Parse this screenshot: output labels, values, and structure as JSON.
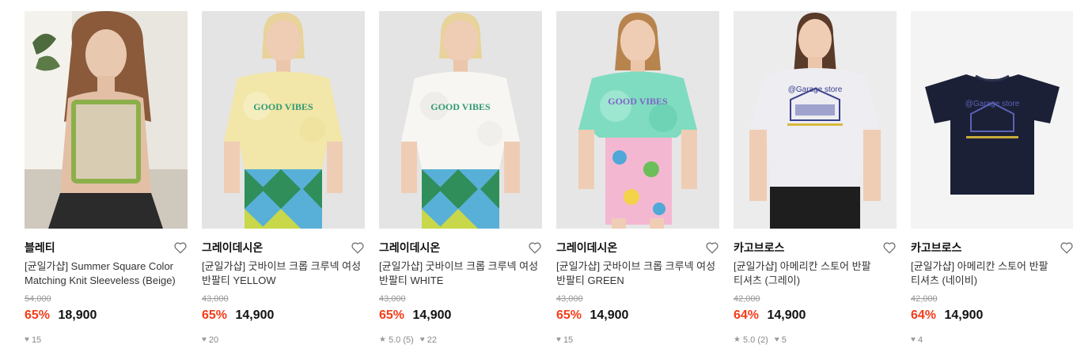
{
  "products": [
    {
      "brand": "블레티",
      "title_line1": "[균일가샵] Summer Square Color",
      "title_line2": "Matching Knit Sleeveless (Beige)",
      "original_price": "54,000",
      "discount": "65%",
      "price": "18,900",
      "rating": "",
      "likes": "15"
    },
    {
      "brand": "그레이데시온",
      "title_line1": "[균일가샵] 굿바이브 크롭 크루넥 여성",
      "title_line2": "반팔티 YELLOW",
      "original_price": "43,000",
      "discount": "65%",
      "price": "14,900",
      "rating": "",
      "likes": "20"
    },
    {
      "brand": "그레이데시온",
      "title_line1": "[균일가샵] 굿바이브 크롭 크루넥 여성",
      "title_line2": "반팔티 WHITE",
      "original_price": "43,000",
      "discount": "65%",
      "price": "14,900",
      "rating": "5.0 (5)",
      "likes": "22"
    },
    {
      "brand": "그레이데시온",
      "title_line1": "[균일가샵] 굿바이브 크롭 크루넥 여성",
      "title_line2": "반팔티 GREEN",
      "original_price": "43,000",
      "discount": "65%",
      "price": "14,900",
      "rating": "",
      "likes": "15"
    },
    {
      "brand": "카고브로스",
      "title_line1": "[균일가샵] 아메리칸 스토어 반팔",
      "title_line2": "티셔츠 (그레이)",
      "original_price": "42,000",
      "discount": "64%",
      "price": "14,900",
      "rating": "5.0 (2)",
      "likes": "5"
    },
    {
      "brand": "카고브로스",
      "title_line1": "[균일가샵] 아메리칸 스토어 반팔",
      "title_line2": "티셔츠 (네이비)",
      "original_price": "42,000",
      "discount": "64%",
      "price": "14,900",
      "rating": "",
      "likes": "4"
    }
  ],
  "shirt_prints": {
    "good_vibes": "GOOD VIBES",
    "garage_store": "@Garage store"
  },
  "icons": {
    "wishlist": "heart-outline-icon",
    "likes": "heart-icon",
    "rating": "star-icon"
  },
  "colors": {
    "discount": "#f43c19",
    "price": "#111111",
    "original_price": "#999999"
  }
}
